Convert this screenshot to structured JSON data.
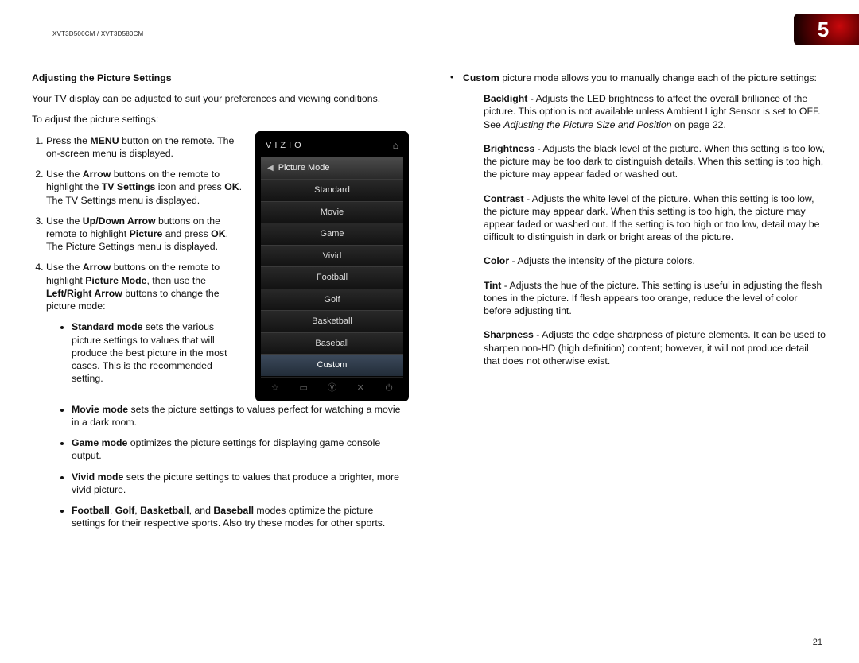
{
  "header_model": "XVT3D500CM / XVT3D580CM",
  "chapter_number": "5",
  "page_number": "21",
  "left": {
    "heading": "Adjusting the Picture Settings",
    "intro": "Your TV display can be adjusted to suit your preferences and viewing conditions.",
    "lead": "To adjust the picture settings:",
    "step1_a": "Press the ",
    "step1_b": "MENU",
    "step1_c": " button on the remote. The on-screen menu is displayed.",
    "step2_a": "Use the ",
    "step2_b": "Arrow",
    "step2_c": " buttons on the remote to highlight the ",
    "step2_d": "TV Settings",
    "step2_e": " icon and press ",
    "step2_f": "OK",
    "step2_g": ". The TV Settings menu is displayed.",
    "step3_a": "Use the ",
    "step3_b": "Up/Down Arrow",
    "step3_c": " buttons on the remote to highlight ",
    "step3_d": "Picture",
    "step3_e": " and press ",
    "step3_f": "OK",
    "step3_g": ". The Picture Settings menu is displayed.",
    "step4_a": "Use the ",
    "step4_b": "Arrow",
    "step4_c": " buttons on the remote to highlight ",
    "step4_d": "Picture Mode",
    "step4_e": ", then use the ",
    "step4_f": "Left/Right Arrow",
    "step4_g": " buttons to change the picture mode:",
    "mode_std_b": "Standard mode",
    "mode_std_t": " sets the various picture settings to values that will produce the best picture in the most cases. This is the recommended setting.",
    "mode_mov_b": "Movie mode",
    "mode_mov_t": " sets the picture settings to values perfect for watching a movie in a dark room.",
    "mode_game_b": "Game mode",
    "mode_game_t": " optimizes the picture settings for displaying game console output.",
    "mode_vivid_b": "Vivid mode",
    "mode_vivid_t": " sets the picture settings to values that produce a brighter, more vivid picture.",
    "mode_sport_b1": "Football",
    "mode_sport_s1": ", ",
    "mode_sport_b2": "Golf",
    "mode_sport_s2": ", ",
    "mode_sport_b3": "Basketball",
    "mode_sport_s3": ", and ",
    "mode_sport_b4": "Baseball",
    "mode_sport_t": " modes optimize the picture settings for their respective sports. Also try these modes for other sports."
  },
  "right": {
    "custom_b": "Custom",
    "custom_t": " picture mode allows you to manually change each of the picture settings:",
    "bl_b": "Backlight",
    "bl_t": " - Adjusts the LED brightness to affect the overall brilliance of the picture. This option is not available unless Ambient Light Sensor is set to OFF. See ",
    "bl_i": "Adjusting the Picture Size and Position",
    "bl_t2": " on page 22.",
    "br_b": "Brightness",
    "br_t": " - Adjusts the black level of the picture. When this setting is too low, the picture may be too dark to distinguish details. When this setting is too high, the picture may appear faded or washed out.",
    "ct_b": "Contrast",
    "ct_t": " - Adjusts the white level of the picture. When this setting is too low, the picture may appear dark. When this setting is too high, the picture may appear faded or washed out. If the setting is too high or too low, detail may be difficult to distinguish in dark or bright areas of the picture.",
    "co_b": "Color",
    "co_t": " - Adjusts the intensity of the picture colors.",
    "ti_b": "Tint",
    "ti_t": " - Adjusts the hue of the picture. This setting is useful in adjusting the flesh tones in the picture. If flesh appears too orange, reduce the level of color before adjusting tint.",
    "sh_b": "Sharpness",
    "sh_t": " - Adjusts the edge sharpness of picture elements. It can be used to sharpen non-HD (high definition) content; however, it will not produce detail that does not otherwise exist."
  },
  "tv": {
    "brand": "VIZIO",
    "title": "Picture Mode",
    "rows": [
      "Standard",
      "Movie",
      "Game",
      "Vivid",
      "Football",
      "Golf",
      "Basketball",
      "Baseball",
      "Custom"
    ],
    "selected": "Custom"
  }
}
